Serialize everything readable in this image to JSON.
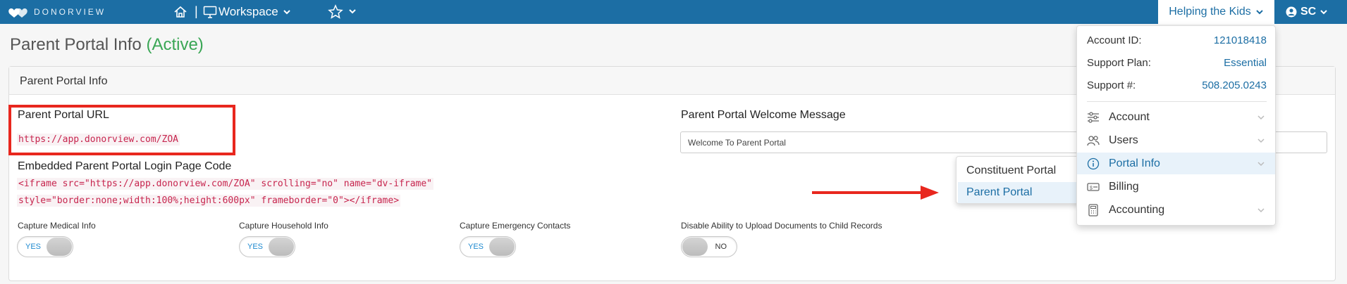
{
  "brand": {
    "logo_text": "DONORVIEW",
    "accent": "#1c6ea4",
    "success": "#3aa655"
  },
  "topbar": {
    "home_icon": "home-icon",
    "separator": "|",
    "workspace_label": "Workspace",
    "org_name": "Helping the Kids",
    "user_initials": "SC"
  },
  "page": {
    "title": "Parent Portal Info",
    "status": "(Active)"
  },
  "panel": {
    "header": "Parent Portal Info",
    "url_label": "Parent Portal URL",
    "url_value": "https://app.donorview.com/ZOA",
    "embed_label": "Embedded Parent Portal Login Page Code",
    "embed_line1": "<iframe src=\"https://app.donorview.com/ZOA\" scrolling=\"no\" name=\"dv-iframe\"",
    "embed_line2": "style=\"border:none;width:100%;height:600px\" frameborder=\"0\"></iframe>",
    "welcome_label": "Parent Portal Welcome Message",
    "welcome_value": "Welcome To Parent Portal"
  },
  "toggles": [
    {
      "label": "Capture Medical Info",
      "state": "YES"
    },
    {
      "label": "Capture Household Info",
      "state": "YES"
    },
    {
      "label": "Capture Emergency Contacts",
      "state": "YES"
    },
    {
      "label": "Disable Ability to Upload Documents to Child Records",
      "state": "NO"
    }
  ],
  "account_menu": {
    "account_id_label": "Account ID:",
    "account_id": "121018418",
    "support_plan_label": "Support Plan:",
    "support_plan": "Essential",
    "support_phone_label": "Support #:",
    "support_phone": "508.205.0243",
    "items": [
      {
        "label": "Account",
        "icon": "sliders-icon"
      },
      {
        "label": "Users",
        "icon": "users-icon"
      },
      {
        "label": "Portal Info",
        "icon": "info-icon",
        "active": true
      },
      {
        "label": "Billing",
        "icon": "billing-icon"
      },
      {
        "label": "Accounting",
        "icon": "calculator-icon"
      }
    ]
  },
  "portal_submenu": {
    "items": [
      {
        "label": "Constituent Portal"
      },
      {
        "label": "Parent Portal",
        "active": true
      }
    ]
  }
}
